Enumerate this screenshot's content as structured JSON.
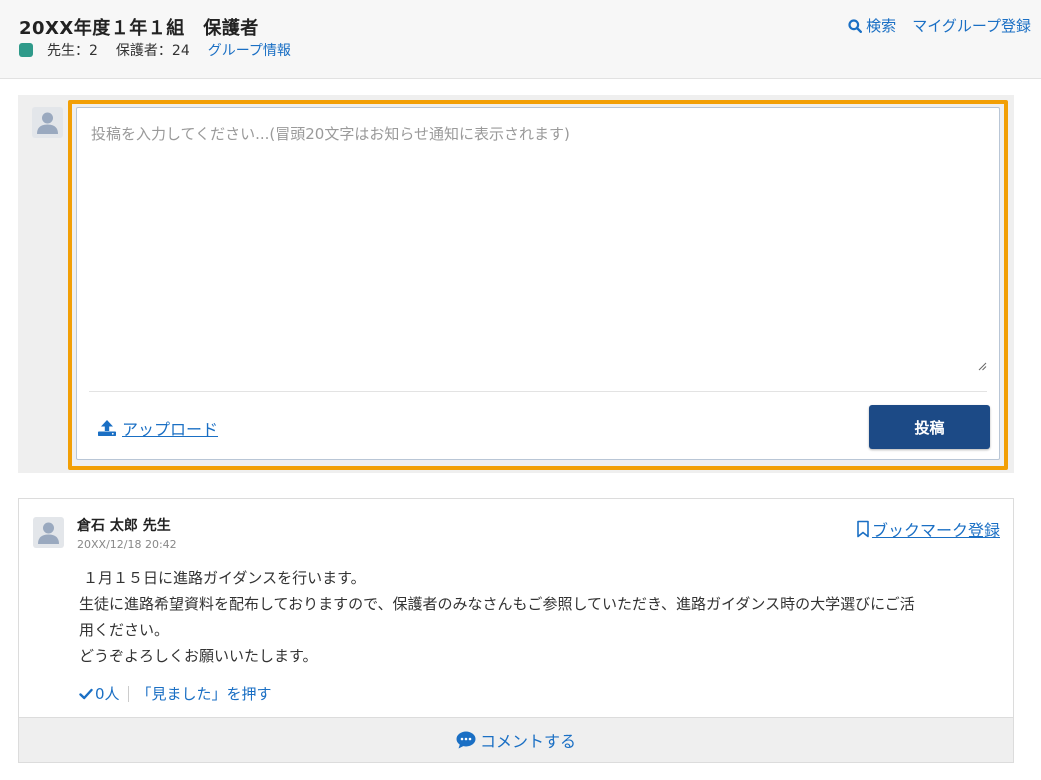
{
  "header": {
    "title": "20XX年度１年１組　保護者",
    "teachers": "先生：2",
    "guardians": "保護者：24",
    "group_info_link": "グループ情報",
    "search_label": "検索",
    "my_group_register": "マイグループ登録",
    "group_color": "#2f9a8a"
  },
  "compose": {
    "placeholder": "投稿を入力してください...(冒頭20文字はお知らせ通知に表示されます)",
    "upload_label": "アップロード",
    "post_button_label": "投稿",
    "highlight_color": "#f29f05"
  },
  "post": {
    "author": "倉石 太郎 先生",
    "timestamp": "20XX/12/18 20:42",
    "bookmark_label": "ブックマーク登録",
    "body_lines": [
      "１月１５日に進路ガイダンスを行います。",
      "生徒に進路希望資料を配布しておりますので、保護者のみなさんもご参照していただき、進路ガイダンス時の大学選びにご活",
      "用ください。",
      "どうぞよろしくお願いいたします。"
    ],
    "seen_count": "0人",
    "seen_button": "「見ました」を押す",
    "comment_label": "コメントする"
  },
  "colors": {
    "accent_link": "#1a6fc4",
    "primary_button": "#1c4a86"
  },
  "icons": {
    "search": "search-icon",
    "avatar": "user-avatar-icon",
    "upload": "upload-icon",
    "bookmark": "bookmark-icon",
    "check": "check-icon",
    "comment": "comment-bubble-icon",
    "resize": "resize-handle-icon"
  }
}
